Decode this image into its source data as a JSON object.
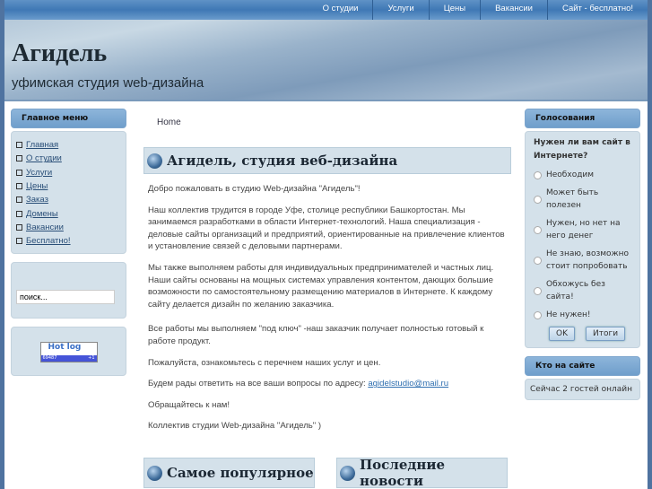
{
  "nav": [
    "О студии",
    "Услуги",
    "Цены",
    "Вакансии",
    "Сайт - бесплатно!"
  ],
  "site": {
    "title": "Агидель",
    "slogan": "уфимская студия web-дизайна"
  },
  "main_menu": {
    "title": "Главное меню",
    "items": [
      "Главная",
      "О студии",
      "Услуги",
      "Цены",
      "Заказ",
      "Домены",
      "Вакансии",
      "Бесплатно!"
    ]
  },
  "search": {
    "value": "поиск..."
  },
  "counter": {
    "label": "Hot log",
    "views": "69487",
    "today": "+1"
  },
  "breadcrumb": "Home",
  "article": {
    "title": "Агидель, студия веб-дизайна",
    "paragraphs": [
      "Добро пожаловать в студию Web-дизайна \"Агидель\"!",
      "Наш коллектив трудится в городе Уфе, столице республики Башкортостан. Мы занимаемся разработками в области Интернет-технологий. Наша специализация - деловые сайты организаций и предприятий, ориентированные на привлечение клиентов и установление связей с деловыми партнерами.",
      "Мы также выполняем работы для индивидуальных предпринимателей и частных лиц. Наши сайты основаны на мощных системах управления контентом, дающих большие возможности по самостоятельному размещению материалов в Интернете. К каждому сайту делается дизайн по желанию заказчика."
    ],
    "p4": "Все работы мы выполняем \"под ключ\"  -наш заказчик получает полностью готовый к работе продукт.",
    "p5": "Пожалуйста, ознакомьтесь с перечнем наших услуг и цен.",
    "p6": "Будем рады ответить на все ваши вопросы по адресу: ",
    "email": "agidelstudio@mail.ru",
    "p7": "Обращайтесь к нам!",
    "p8": "Коллектив студии Web-дизайна \"Агидель\" )"
  },
  "bottom": {
    "popular": "Самое популярное",
    "news": "Последние новости"
  },
  "poll": {
    "title": "Голосования",
    "question": "Нужен ли вам сайт в Интернете?",
    "options": [
      "Необходим",
      "Может быть полезен",
      "Нужен, но нет на него денег",
      "Не знаю, возможно стоит попробовать",
      "Обхожусь без сайта!",
      "Не нужен!"
    ],
    "ok": "OK",
    "results": "Итоги"
  },
  "online": {
    "title": "Кто на сайте",
    "text": "Сейчас 2 гостей онлайн"
  }
}
